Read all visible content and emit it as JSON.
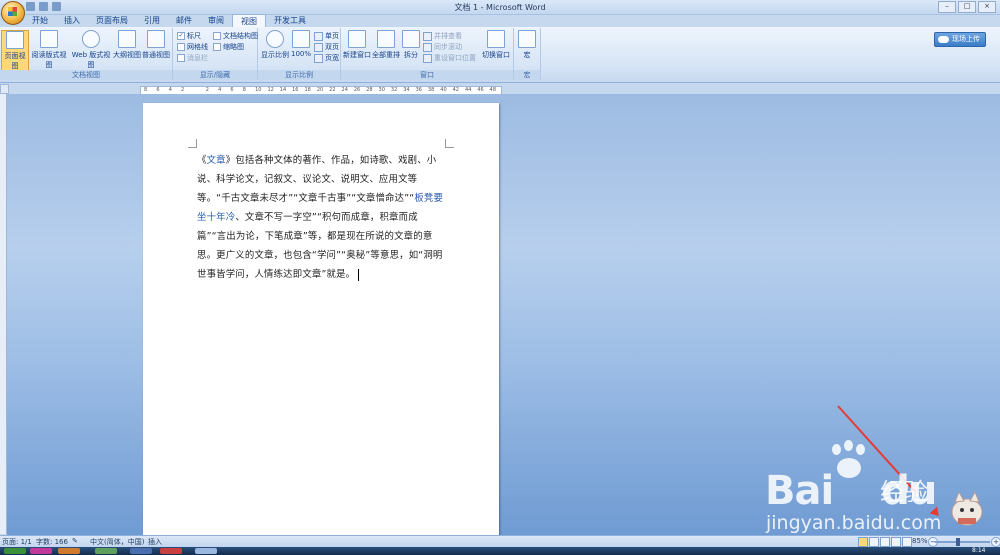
{
  "window": {
    "title": "文档 1 - Microsoft Word"
  },
  "tabs": [
    "开始",
    "插入",
    "页面布局",
    "引用",
    "邮件",
    "审阅",
    "视图",
    "开发工具"
  ],
  "active_tab_index": 6,
  "ribbon": {
    "upload_label": "现场上传",
    "groups": {
      "doc_views": {
        "name": "文档视图",
        "buttons": [
          "页面视图",
          "阅读版式视图",
          "Web 版式视图",
          "大纲视图",
          "普通视图"
        ]
      },
      "show_hide": {
        "name": "显示/隐藏",
        "checks": [
          {
            "label": "标尺",
            "checked": true
          },
          {
            "label": "网格线",
            "checked": false
          },
          {
            "label": "消息栏",
            "checked": false,
            "disabled": true
          },
          {
            "label": "文档结构图",
            "checked": false
          },
          {
            "label": "缩略图",
            "checked": false
          }
        ]
      },
      "zoom": {
        "name": "显示比例",
        "buttons": [
          "显示比例",
          "100%"
        ],
        "small": [
          "单页",
          "双页",
          "页宽"
        ]
      },
      "window": {
        "name": "窗口",
        "buttons": [
          "新建窗口",
          "全部重排",
          "拆分"
        ],
        "small": [
          "并排查看",
          "同步滚动",
          "重设窗口位置"
        ],
        "switch_label": "切换窗口"
      },
      "macro": {
        "name": "宏",
        "button": "宏"
      }
    }
  },
  "ruler": {
    "marks": [
      "8",
      "6",
      "4",
      "2",
      "",
      "2",
      "4",
      "6",
      "8",
      "10",
      "12",
      "14",
      "16",
      "18",
      "20",
      "22",
      "24",
      "26",
      "28",
      "30",
      "32",
      "34",
      "36",
      "38",
      "40",
      "42",
      "44",
      "46",
      "48"
    ]
  },
  "document": {
    "p1": "《",
    "link1": "文章",
    "p2": "》包括各种文体的著作、作品，如诗歌、戏剧、小说、科学论文，记叙文、议论文、说明文、应用文等等。“千古文章未尽才”“文章千古事”“文章憎命达”“",
    "link2": "板凳要坐十年冷",
    "p3": "、文章不写一字空”“积句而成章，积章而成篇”“言出为论，下笔成章”等，都是现在所说的文章的意思。更广义的文章，也包含“学问”“奥秘”等意思，如“洞明世事皆学问，人情练达即文章”就是。"
  },
  "statusbar": {
    "page": "页面: 1/1",
    "words": "字数: 166",
    "language": "中文(简体，中国)",
    "mode": "插入",
    "zoom": "85%",
    "zoom_level_pct": 85
  },
  "taskbar": {
    "clock": "8:14"
  },
  "watermark": {
    "brand": "Bai",
    "brand2": "du",
    "sub": "经验",
    "url": "jingyan.baidu.com"
  },
  "colors": {
    "accent": "#2a5cae",
    "selected": "#ffd87a",
    "annotation": "#e53b35"
  }
}
